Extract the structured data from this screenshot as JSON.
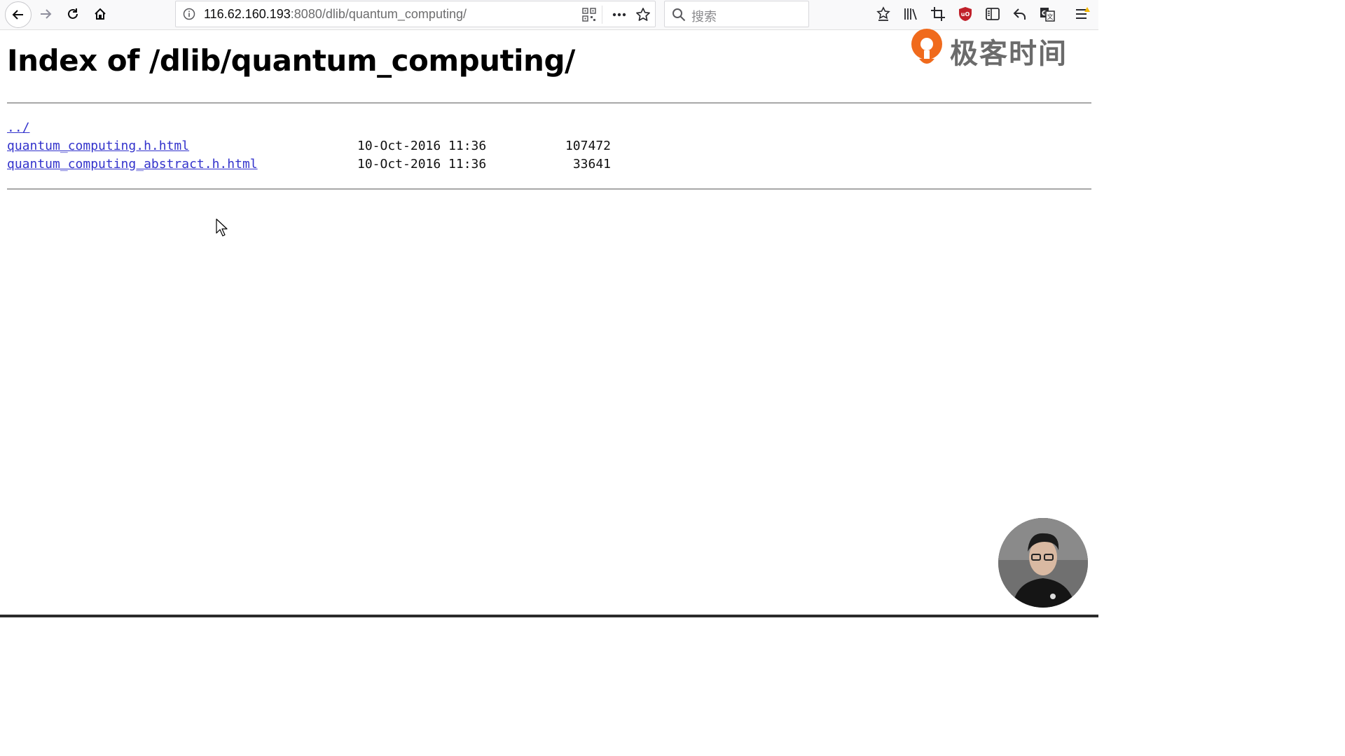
{
  "browser": {
    "url_host": "116.62.160.193",
    "url_rest": ":8080/dlib/quantum_computing/",
    "search_placeholder": "搜索"
  },
  "page": {
    "title": "Index of /dlib/quantum_computing/",
    "entries": [
      {
        "name": "../",
        "date": "",
        "size": ""
      },
      {
        "name": "quantum_computing.h.html",
        "date": "10-Oct-2016 11:36",
        "size": "107472"
      },
      {
        "name": "quantum_computing_abstract.h.html",
        "date": "10-Oct-2016 11:36",
        "size": "33641"
      }
    ]
  },
  "watermark": {
    "text": "极客时间"
  },
  "colors": {
    "accent": "#f06a1c",
    "link": "#3333cc",
    "ublock": "#c0202a"
  },
  "icons": [
    "back-arrow-icon",
    "forward-arrow-icon",
    "reload-icon",
    "home-icon",
    "info-icon",
    "qr-code-icon",
    "more-icon",
    "star-icon",
    "search-icon",
    "bookmark-down-icon",
    "library-icon",
    "crop-icon",
    "ublock-icon",
    "sidebar-icon",
    "undo-icon",
    "translate-icon",
    "menu-icon"
  ]
}
